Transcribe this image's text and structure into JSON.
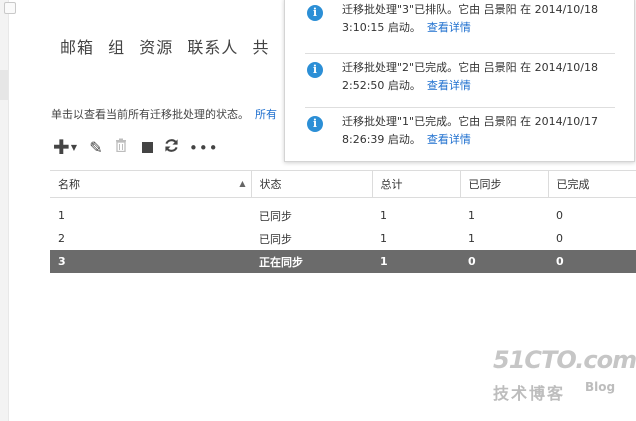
{
  "tabs": [
    "邮箱",
    "组",
    "资源",
    "联系人",
    "共"
  ],
  "description": {
    "text": "单击以查看当前所有迁移批处理的状态。",
    "link": "所有"
  },
  "toolbar": {
    "add_icon": "plus-icon",
    "edit_icon": "pencil-icon",
    "delete_icon": "trash-icon",
    "stop_icon": "stop-icon",
    "refresh_icon": "refresh-icon",
    "more_icon": "ellipsis-icon"
  },
  "table": {
    "columns": [
      "名称",
      "状态",
      "总计",
      "已同步",
      "已完成"
    ],
    "sorted_column": "名称",
    "rows": [
      [
        "1",
        "已同步",
        "1",
        "1",
        "0"
      ],
      [
        "2",
        "已同步",
        "1",
        "1",
        "0"
      ],
      [
        "3",
        "正在同步",
        "1",
        "0",
        "0"
      ]
    ],
    "selected_row": 2
  },
  "notifications": [
    {
      "icon": "info-icon",
      "message": "迁移批处理\"3\"已排队。它由 吕景阳 在 2014/10/18 3:10:15 启动。",
      "link": "查看详情"
    },
    {
      "icon": "info-icon",
      "message": "迁移批处理\"2\"已完成。它由 吕景阳 在 2014/10/18 2:52:50 启动。",
      "link": "查看详情"
    },
    {
      "icon": "info-icon",
      "message": "迁移批处理\"1\"已完成。它由 吕景阳 在 2014/10/17 8:26:39 启动。",
      "link": "查看详情"
    }
  ],
  "watermark": {
    "logo": "51CTO.com",
    "sub": "技术博客",
    "blog": "Blog"
  },
  "colors": {
    "accent_link": "#1e6fcf",
    "selected_row": "#6b6b6b",
    "info_icon": "#2c8fd6"
  }
}
